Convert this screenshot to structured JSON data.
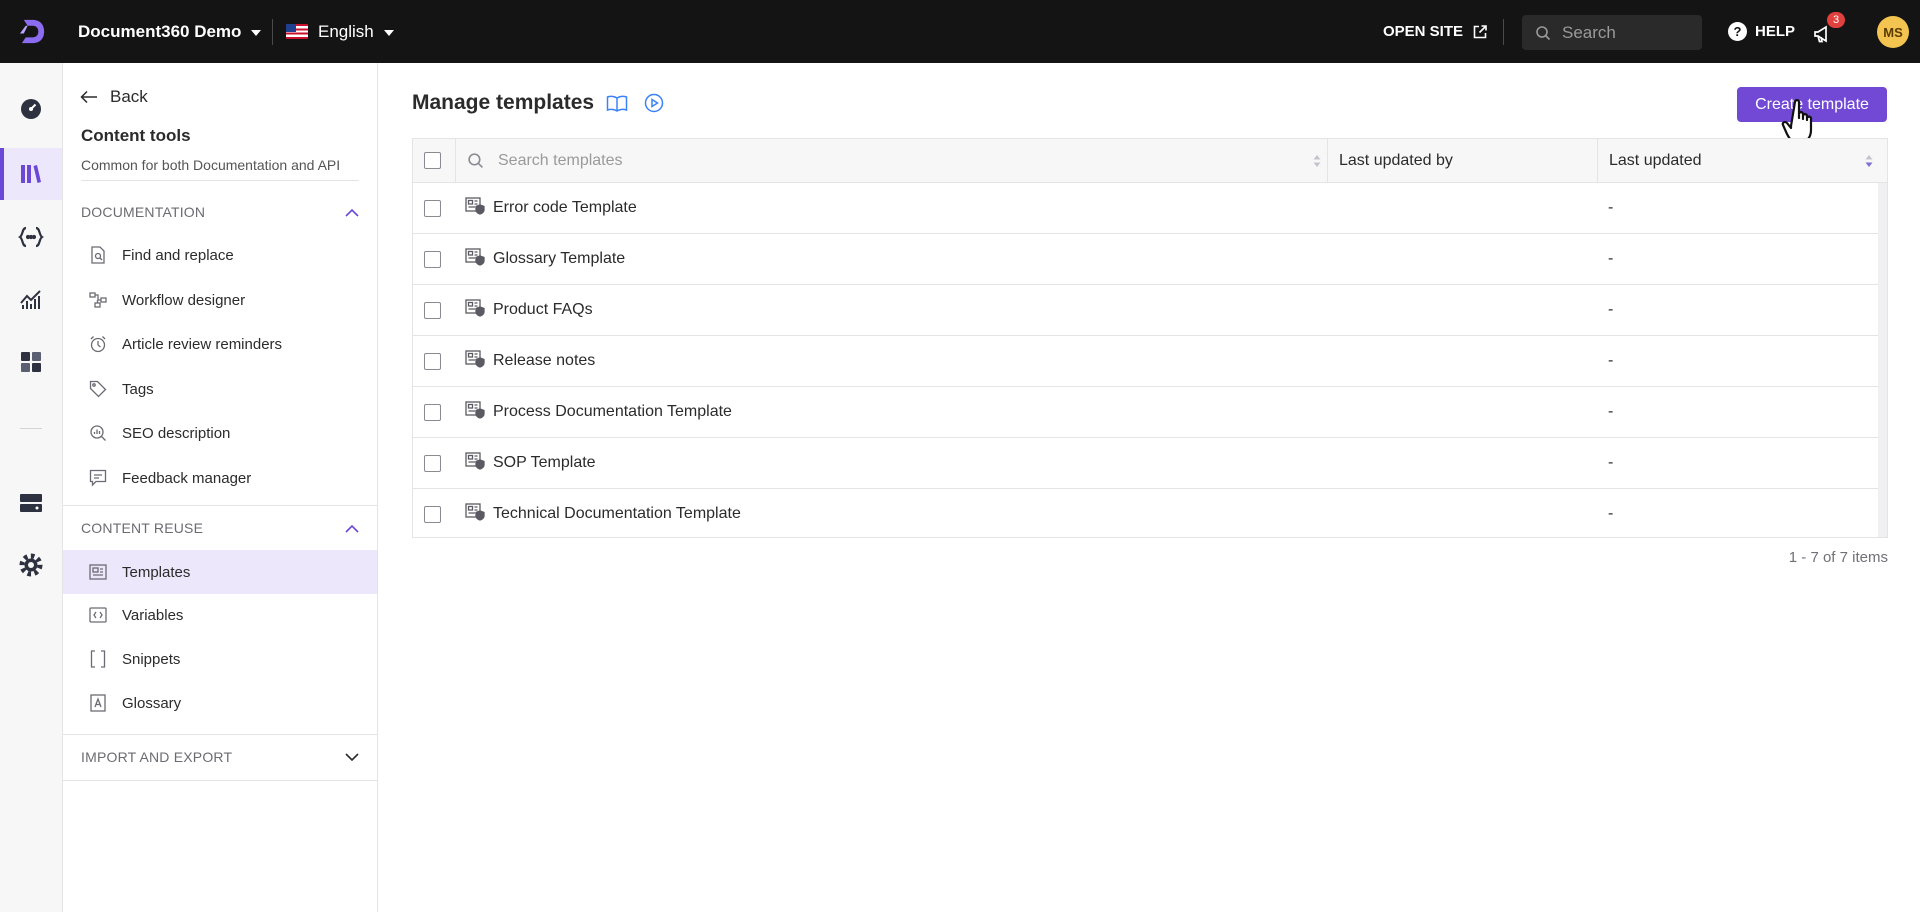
{
  "topbar": {
    "project": "Document360 Demo",
    "language": "English",
    "open_site": "OPEN SITE",
    "search_placeholder": "Search",
    "help": "HELP",
    "notification_count": "3",
    "avatar_initials": "MS"
  },
  "rail": {
    "items": [
      "dashboard-icon",
      "documentation-icon",
      "api-docs-icon",
      "analytics-icon",
      "widgets-icon",
      "drive-icon",
      "settings-icon"
    ],
    "active": "documentation-icon"
  },
  "subnav": {
    "back": "Back",
    "title": "Content tools",
    "subtitle": "Common for both Documentation and API",
    "sections": {
      "documentation": {
        "label": "DOCUMENTATION",
        "items": [
          "Find and replace",
          "Workflow designer",
          "Article review reminders",
          "Tags",
          "SEO description",
          "Feedback manager"
        ]
      },
      "content_reuse": {
        "label": "CONTENT REUSE",
        "items": [
          "Templates",
          "Variables",
          "Snippets",
          "Glossary"
        ],
        "active": "Templates"
      },
      "import_export": {
        "label": "IMPORT AND EXPORT"
      }
    }
  },
  "main": {
    "title": "Manage templates",
    "create_button": "Create template",
    "table": {
      "search_placeholder": "Search templates",
      "columns": [
        "Last updated by",
        "Last updated"
      ],
      "rows": [
        {
          "name": "Error code Template",
          "updated_by": "",
          "updated": "-"
        },
        {
          "name": "Glossary Template",
          "updated_by": "",
          "updated": "-"
        },
        {
          "name": "Product FAQs",
          "updated_by": "",
          "updated": "-"
        },
        {
          "name": "Release notes",
          "updated_by": "",
          "updated": "-"
        },
        {
          "name": "Process Documentation Template",
          "updated_by": "",
          "updated": "-"
        },
        {
          "name": "SOP Template",
          "updated_by": "",
          "updated": "-"
        },
        {
          "name": "Technical Documentation Template",
          "updated_by": "",
          "updated": "-"
        }
      ]
    },
    "pager": "1 - 7 of 7 items"
  },
  "colors": {
    "accent": "#7149d4",
    "topbar": "#141414",
    "active_bg": "#ece7fb",
    "badge": "#e0413f",
    "avatar": "#f3c44f"
  }
}
